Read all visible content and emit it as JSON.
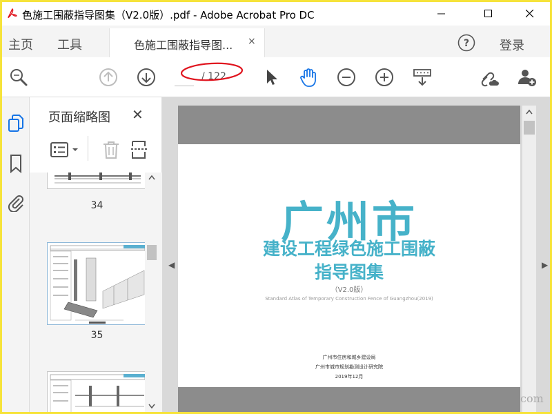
{
  "window": {
    "title": "色施工围蔽指导图集（V2.0版）.pdf - Adobe Acrobat Pro DC",
    "minimize_icon": "minimize-icon",
    "maximize_icon": "maximize-icon",
    "close_icon": "close-icon"
  },
  "menu": {
    "home": "主页",
    "tools": "工具",
    "login": "登录",
    "help_icon": "help-icon"
  },
  "tab": {
    "label": "色施工围蔽指导图...",
    "close": "×"
  },
  "toolbar": {
    "page_current": "",
    "page_total": "/ 122",
    "annotation_color": "#e0141e"
  },
  "panel": {
    "title": "页面缩略图",
    "close": "✕",
    "thumbnails": [
      {
        "page": "34"
      },
      {
        "page": "35"
      }
    ]
  },
  "document": {
    "title_big": "广州市",
    "title_line2": "建设工程绿色施工围蔽",
    "title_line3": "指导图集",
    "version": "（V2.0版）",
    "subtitle_en": "Standard Atlas of Temporary Construction Fence of Guangzhou(2019)",
    "publisher1": "广州市住房和城乡建设局",
    "publisher2": "广州市城市规划勘测设计研究院",
    "date": "2019年12月",
    "accent_color": "#46b2c9"
  },
  "watermark": "com"
}
